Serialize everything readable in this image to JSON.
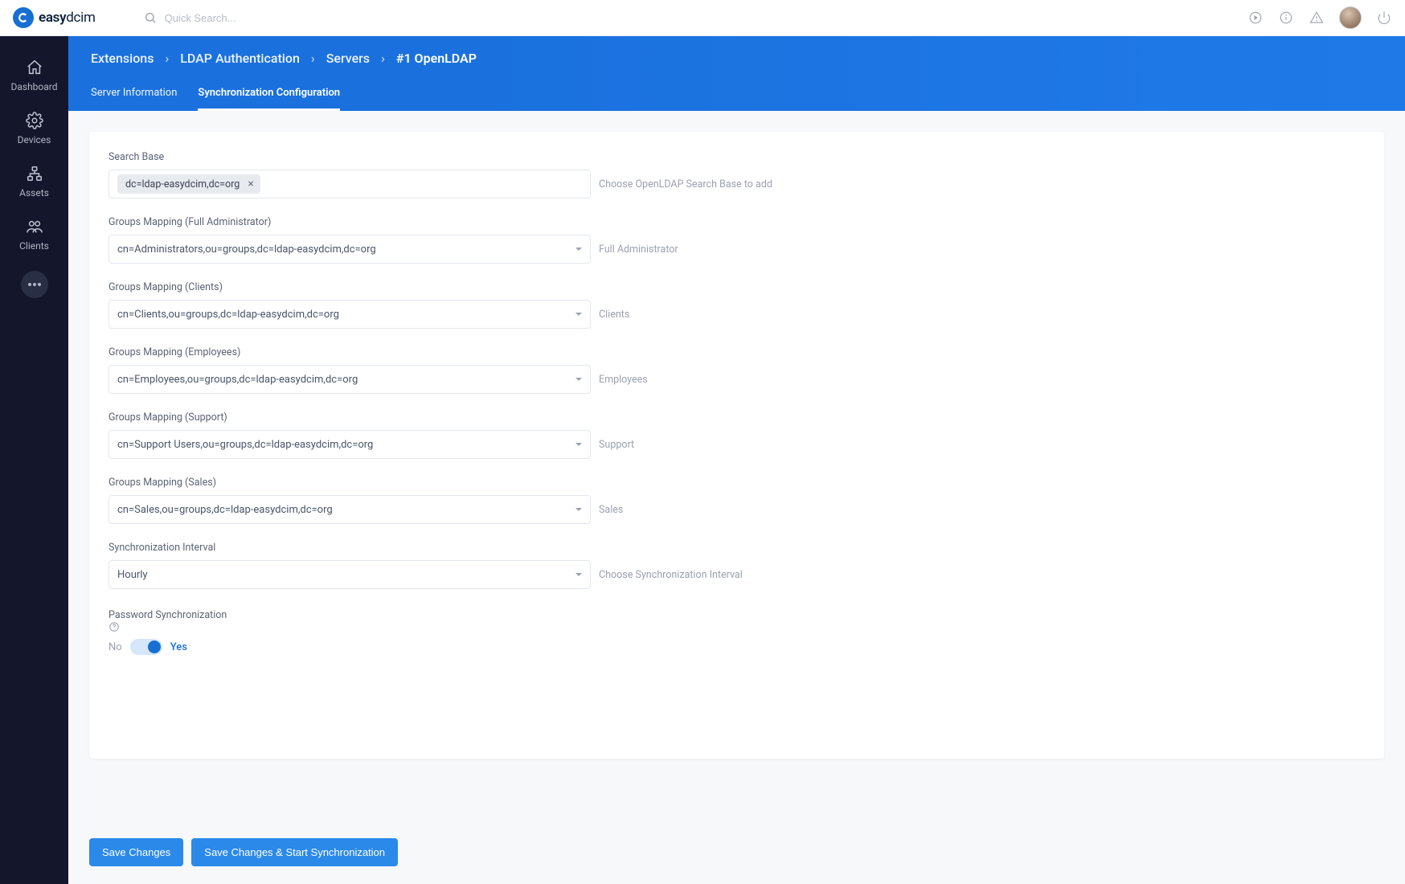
{
  "brand": {
    "name_a": "easy",
    "name_b": "dcim"
  },
  "search": {
    "placeholder": "Quick Search..."
  },
  "sidebar": {
    "items": [
      {
        "label": "Dashboard"
      },
      {
        "label": "Devices"
      },
      {
        "label": "Assets"
      },
      {
        "label": "Clients"
      }
    ]
  },
  "breadcrumbs": {
    "a": "Extensions",
    "b": "LDAP Authentication",
    "c": "Servers",
    "d": "#1 OpenLDAP"
  },
  "tabs": {
    "info": "Server Information",
    "sync": "Synchronization Configuration"
  },
  "form": {
    "searchBase": {
      "label": "Search Base",
      "chip": "dc=ldap-easydcim,dc=org",
      "help": "Choose OpenLDAP Search Base to add"
    },
    "groups": [
      {
        "label": "Groups Mapping (Full Administrator)",
        "value": "cn=Administrators,ou=groups,dc=ldap-easydcim,dc=org",
        "help": "Full Administrator"
      },
      {
        "label": "Groups Mapping (Clients)",
        "value": "cn=Clients,ou=groups,dc=ldap-easydcim,dc=org",
        "help": "Clients"
      },
      {
        "label": "Groups Mapping (Employees)",
        "value": "cn=Employees,ou=groups,dc=ldap-easydcim,dc=org",
        "help": "Employees"
      },
      {
        "label": "Groups Mapping (Support)",
        "value": "cn=Support Users,ou=groups,dc=ldap-easydcim,dc=org",
        "help": "Support"
      },
      {
        "label": "Groups Mapping (Sales)",
        "value": "cn=Sales,ou=groups,dc=ldap-easydcim,dc=org",
        "help": "Sales"
      }
    ],
    "interval": {
      "label": "Synchronization Interval",
      "value": "Hourly",
      "help": "Choose Synchronization Interval"
    },
    "passwordSync": {
      "label": "Password Synchronization",
      "no": "No",
      "yes": "Yes",
      "on": true
    }
  },
  "footer": {
    "save": "Save Changes",
    "saveStart": "Save Changes & Start Synchronization"
  }
}
